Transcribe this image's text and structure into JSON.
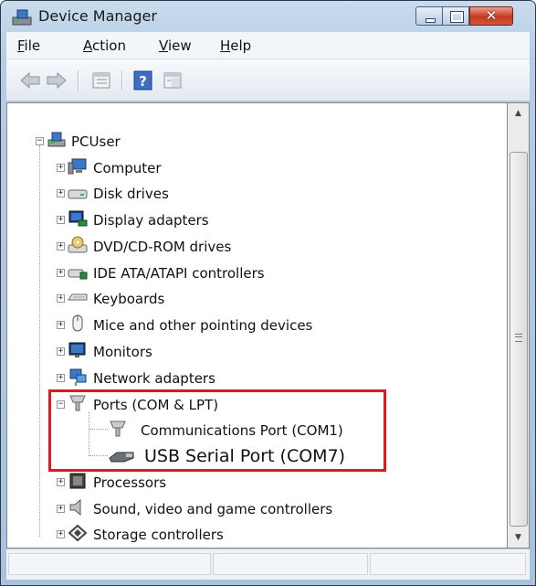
{
  "window": {
    "title": "Device Manager"
  },
  "menu": [
    {
      "label": "File",
      "accel": "F",
      "rest": "ile"
    },
    {
      "label": "Action",
      "accel": "A",
      "rest": "ction"
    },
    {
      "label": "View",
      "accel": "V",
      "rest": "iew"
    },
    {
      "label": "Help",
      "accel": "H",
      "rest": "elp"
    }
  ],
  "toolbar": {
    "buttons": [
      "back-arrow-icon",
      "forward-arrow-icon",
      "properties-icon",
      "help-icon",
      "show-hide-console-tree-icon"
    ]
  },
  "tree": {
    "root": "PCUser",
    "categories": [
      {
        "label": "Computer",
        "icon": "computer-icon"
      },
      {
        "label": "Disk drives",
        "icon": "disk-drive-icon"
      },
      {
        "label": "Display adapters",
        "icon": "display-adapter-icon"
      },
      {
        "label": "DVD/CD-ROM drives",
        "icon": "dvd-drive-icon"
      },
      {
        "label": "IDE ATA/ATAPI controllers",
        "icon": "ide-controller-icon"
      },
      {
        "label": "Keyboards",
        "icon": "keyboard-icon"
      },
      {
        "label": "Mice and other pointing devices",
        "icon": "mouse-icon"
      },
      {
        "label": "Monitors",
        "icon": "monitor-icon"
      },
      {
        "label": "Network adapters",
        "icon": "network-adapter-icon"
      },
      {
        "label": "Ports (COM & LPT)",
        "icon": "port-icon",
        "expanded": true
      },
      {
        "label": "Processors",
        "icon": "processor-icon"
      },
      {
        "label": "Sound, video and game controllers",
        "icon": "sound-icon"
      },
      {
        "label": "Storage controllers",
        "icon": "storage-controller-icon"
      }
    ],
    "ports_children": [
      {
        "label": "Communications Port (COM1)",
        "icon": "serial-port-icon"
      },
      {
        "label": "USB Serial Port (COM7)",
        "icon": "usb-serial-icon"
      }
    ]
  },
  "colors": {
    "highlight_border": "#e0191f",
    "title_bar": "#b7cde4"
  }
}
